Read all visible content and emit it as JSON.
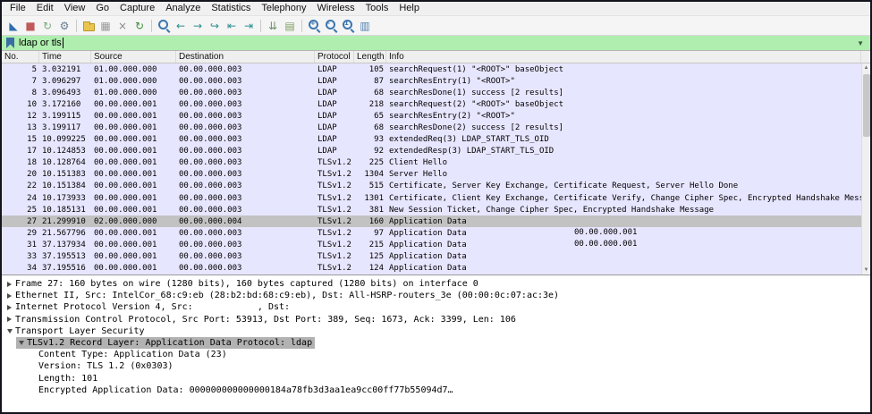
{
  "app": {
    "name": "Wireshark"
  },
  "menu": {
    "items": [
      "File",
      "Edit",
      "View",
      "Go",
      "Capture",
      "Analyze",
      "Statistics",
      "Telephony",
      "Wireless",
      "Tools",
      "Help"
    ]
  },
  "toolbar": {
    "icons": [
      {
        "name": "start-capture-icon",
        "kind": "glyph",
        "glyph": "◣",
        "color": "#2f6eb0"
      },
      {
        "name": "stop-capture-icon",
        "kind": "glyph",
        "glyph": "■",
        "color": "#c05a5a"
      },
      {
        "name": "restart-capture-icon",
        "kind": "glyph",
        "glyph": "↻",
        "color": "#7ba87b"
      },
      {
        "name": "capture-options-icon",
        "kind": "glyph",
        "glyph": "⚙",
        "color": "#6a7f93"
      },
      {
        "kind": "sep"
      },
      {
        "name": "open-file-icon",
        "kind": "folder"
      },
      {
        "name": "save-file-icon",
        "kind": "glyph",
        "glyph": "▦",
        "color": "#9a9a9a"
      },
      {
        "name": "close-file-icon",
        "kind": "glyph",
        "glyph": "×",
        "color": "#8a8a8a"
      },
      {
        "name": "reload-icon",
        "kind": "glyph",
        "glyph": "↻",
        "color": "#3a8f3a"
      },
      {
        "kind": "sep"
      },
      {
        "name": "find-packet-icon",
        "kind": "mag",
        "sub": ""
      },
      {
        "name": "go-back-icon",
        "kind": "glyph",
        "glyph": "←",
        "color": "#2f8f8f"
      },
      {
        "name": "go-forward-icon",
        "kind": "glyph",
        "glyph": "→",
        "color": "#2f8f8f"
      },
      {
        "name": "go-to-packet-icon",
        "kind": "glyph",
        "glyph": "↪",
        "color": "#2f8f8f"
      },
      {
        "name": "first-packet-icon",
        "kind": "glyph",
        "glyph": "⇤",
        "color": "#2f8f8f"
      },
      {
        "name": "last-packet-icon",
        "kind": "glyph",
        "glyph": "⇥",
        "color": "#2f8f8f"
      },
      {
        "kind": "sep"
      },
      {
        "name": "auto-scroll-icon",
        "kind": "glyph",
        "glyph": "⇊",
        "color": "#6a8f6a"
      },
      {
        "name": "colorize-icon",
        "kind": "glyph",
        "glyph": "▤",
        "color": "#7f9f5f"
      },
      {
        "kind": "sep"
      },
      {
        "name": "zoom-in-icon",
        "kind": "mag",
        "sub": "+"
      },
      {
        "name": "zoom-out-icon",
        "kind": "mag",
        "sub": "-"
      },
      {
        "name": "zoom-original-icon",
        "kind": "mag",
        "sub": "1"
      },
      {
        "name": "resize-columns-icon",
        "kind": "glyph",
        "glyph": "▥",
        "color": "#4f7faf"
      }
    ]
  },
  "filter": {
    "value": "ldap or tls"
  },
  "packet_list": {
    "columns": [
      "No.",
      "Time",
      "Source",
      "Destination",
      "Protocol",
      "Length",
      "Info"
    ],
    "rows": [
      {
        "no": "5",
        "time": "3.032191",
        "src": "01.00.000.000",
        "dst": "00.00.000.003",
        "proto": "LDAP",
        "len": "105",
        "info": "searchRequest(1) \"<ROOT>\" baseObject"
      },
      {
        "no": "7",
        "time": "3.096297",
        "src": "01.00.000.000",
        "dst": "00.00.000.003",
        "proto": "LDAP",
        "len": "87",
        "info": "searchResEntry(1) \"<ROOT>\""
      },
      {
        "no": "8",
        "time": "3.096493",
        "src": "01.00.000.000",
        "dst": "00.00.000.003",
        "proto": "LDAP",
        "len": "68",
        "info": "searchResDone(1) success  [2 results]"
      },
      {
        "no": "10",
        "time": "3.172160",
        "src": "00.00.000.001",
        "dst": "00.00.000.003",
        "proto": "LDAP",
        "len": "218",
        "info": "searchRequest(2) \"<ROOT>\" baseObject"
      },
      {
        "no": "12",
        "time": "3.199115",
        "src": "00.00.000.001",
        "dst": "00.00.000.003",
        "proto": "LDAP",
        "len": "65",
        "info": "searchResEntry(2) \"<ROOT>\""
      },
      {
        "no": "13",
        "time": "3.199117",
        "src": "00.00.000.001",
        "dst": "00.00.000.003",
        "proto": "LDAP",
        "len": "68",
        "info": "searchResDone(2) success  [2 results]"
      },
      {
        "no": "15",
        "time": "10.099225",
        "src": "00.00.000.001",
        "dst": "00.00.000.003",
        "proto": "LDAP",
        "len": "93",
        "info": "extendedReq(3) LDAP_START_TLS_OID"
      },
      {
        "no": "17",
        "time": "10.124853",
        "src": "00.00.000.001",
        "dst": "00.00.000.003",
        "proto": "LDAP",
        "len": "92",
        "info": "extendedResp(3) LDAP_START_TLS_OID"
      },
      {
        "no": "18",
        "time": "10.128764",
        "src": "00.00.000.001",
        "dst": "00.00.000.003",
        "proto": "TLSv1.2",
        "len": "225",
        "info": "Client Hello"
      },
      {
        "no": "20",
        "time": "10.151383",
        "src": "00.00.000.001",
        "dst": "00.00.000.003",
        "proto": "TLSv1.2",
        "len": "1304",
        "info": "Server Hello"
      },
      {
        "no": "22",
        "time": "10.151384",
        "src": "00.00.000.001",
        "dst": "00.00.000.003",
        "proto": "TLSv1.2",
        "len": "515",
        "info": "Certificate, Server Key Exchange, Certificate Request, Server Hello Done"
      },
      {
        "no": "24",
        "time": "10.173933",
        "src": "00.00.000.001",
        "dst": "00.00.000.003",
        "proto": "TLSv1.2",
        "len": "1301",
        "info": "Certificate, Client Key Exchange, Certificate Verify, Change Cipher Spec, Encrypted Handshake Message"
      },
      {
        "no": "25",
        "time": "10.185131",
        "src": "00.00.000.001",
        "dst": "00.00.000.003",
        "proto": "TLSv1.2",
        "len": "381",
        "info": "New Session Ticket, Change Cipher Spec, Encrypted Handshake Message"
      },
      {
        "no": "27",
        "time": "21.299910",
        "src": "02.00.000.000",
        "dst": "00.00.000.004",
        "proto": "TLSv1.2",
        "len": "160",
        "info": "Application Data",
        "selected": true
      },
      {
        "no": "29",
        "time": "21.567796",
        "src": "00.00.000.001",
        "dst": "00.00.000.003",
        "proto": "TLSv1.2",
        "len": "97",
        "info": "Application Data",
        "extra": "00.00.000.001"
      },
      {
        "no": "31",
        "time": "37.137934",
        "src": "00.00.000.001",
        "dst": "00.00.000.003",
        "proto": "TLSv1.2",
        "len": "215",
        "info": "Application Data",
        "extra": "00.00.000.001"
      },
      {
        "no": "33",
        "time": "37.195513",
        "src": "00.00.000.001",
        "dst": "00.00.000.003",
        "proto": "TLSv1.2",
        "len": "125",
        "info": "Application Data"
      },
      {
        "no": "34",
        "time": "37.195516",
        "src": "00.00.000.001",
        "dst": "00.00.000.003",
        "proto": "TLSv1.2",
        "len": "124",
        "info": "Application Data"
      }
    ]
  },
  "details": {
    "lines": [
      {
        "level": 0,
        "arrow": "collapsed",
        "text": "Frame 27: 160 bytes on wire (1280 bits), 160 bytes captured (1280 bits) on interface 0"
      },
      {
        "level": 0,
        "arrow": "collapsed",
        "text": "Ethernet II, Src: IntelCor_68:c9:eb (28:b2:bd:68:c9:eb), Dst: All-HSRP-routers_3e (00:00:0c:07:ac:3e)"
      },
      {
        "level": 0,
        "arrow": "collapsed",
        "text": "Internet Protocol Version 4, Src:            , Dst:"
      },
      {
        "level": 0,
        "arrow": "collapsed",
        "text": "Transmission Control Protocol, Src Port: 53913, Dst Port: 389, Seq: 1673, Ack: 3399, Len: 106"
      },
      {
        "level": 0,
        "arrow": "expanded",
        "text": "Transport Layer Security"
      },
      {
        "level": 1,
        "arrow": "expanded",
        "selected": true,
        "text": "TLSv1.2 Record Layer: Application Data Protocol: ldap"
      },
      {
        "level": 2,
        "arrow": null,
        "text": "Content Type: Application Data (23)"
      },
      {
        "level": 2,
        "arrow": null,
        "text": "Version: TLS 1.2 (0x0303)"
      },
      {
        "level": 2,
        "arrow": null,
        "text": "Length: 101"
      },
      {
        "level": 2,
        "arrow": null,
        "text": "Encrypted Application Data: 000000000000000184a78fb3d3aa1ea9cc00ff77b55094d7…"
      }
    ]
  },
  "colors": {
    "accent_blue": "#3b76af",
    "filter_valid_bg": "#afeeaf",
    "row_bg": "#e7e6ff",
    "selected_row_bg": "#c2c2c2",
    "selected_detail_bg": "#b2b2b2"
  }
}
